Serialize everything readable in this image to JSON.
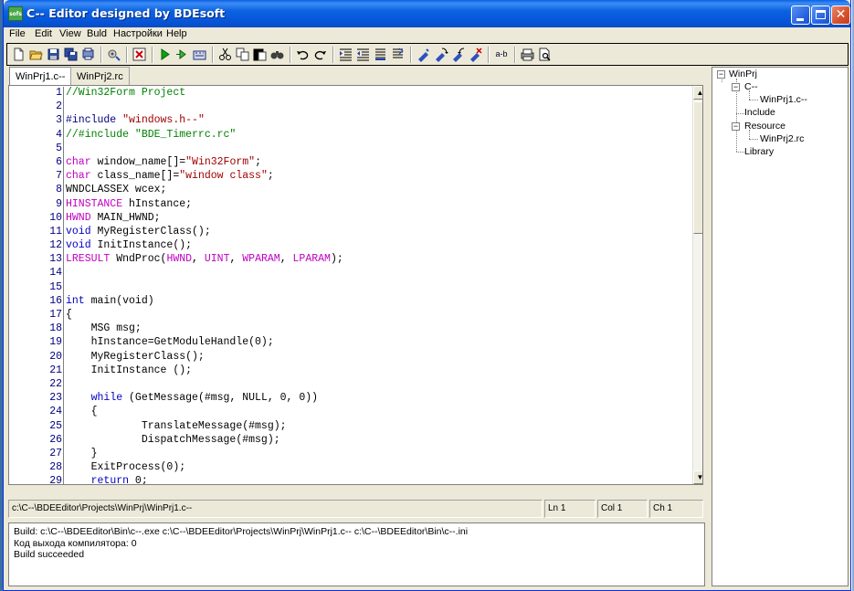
{
  "window": {
    "title": "C-- Editor designed by BDEsoft",
    "icon_label": "sofs",
    "buttons": [
      "minimize",
      "maximize",
      "close"
    ]
  },
  "menu": [
    "File",
    "Edit",
    "View",
    "Buld",
    "Настройки",
    "Help"
  ],
  "toolbar": {
    "icons": [
      "new-file-icon",
      "open-folder-icon",
      "save-icon",
      "save-all-icon",
      "print-setup-icon",
      "settings-icon",
      "compile-icon",
      "stop-icon",
      "run-icon",
      "step-icon",
      "build-all-icon",
      "cut-icon",
      "copy-icon",
      "paste-icon",
      "find-icon",
      "undo-icon",
      "redo-icon",
      "indent-icon",
      "outdent-icon",
      "comment-icon",
      "uncomment-icon",
      "bookmark-icon",
      "next-bookmark-icon",
      "prev-bookmark-icon",
      "clear-bookmarks-icon",
      "replace-icon",
      "print-icon",
      "print-preview-icon"
    ],
    "replace_label": "a-b"
  },
  "tabs": [
    {
      "label": "WinPrj1.c--",
      "active": true
    },
    {
      "label": "WinPrj2.rc",
      "active": false
    }
  ],
  "code": [
    {
      "n": "1",
      "tokens": [
        {
          "t": "//Win32Form Project",
          "c": "c-com"
        }
      ]
    },
    {
      "n": "2",
      "tokens": []
    },
    {
      "n": "3",
      "tokens": [
        {
          "t": "#include ",
          "c": "c-pp"
        },
        {
          "t": "\"windows.h--\"",
          "c": "c-str"
        }
      ]
    },
    {
      "n": "4",
      "tokens": [
        {
          "t": "//#include \"BDE_Timerrc.rc\"",
          "c": "c-com"
        }
      ]
    },
    {
      "n": "5",
      "tokens": []
    },
    {
      "n": "6",
      "tokens": [
        {
          "t": "char",
          "c": "c-type"
        },
        {
          "t": " window_name[]=",
          "c": "c-txt"
        },
        {
          "t": "\"Win32Form\"",
          "c": "c-str"
        },
        {
          "t": ";",
          "c": "c-txt"
        }
      ]
    },
    {
      "n": "7",
      "tokens": [
        {
          "t": "char",
          "c": "c-type"
        },
        {
          "t": " class_name[]=",
          "c": "c-txt"
        },
        {
          "t": "\"window class\"",
          "c": "c-str"
        },
        {
          "t": ";",
          "c": "c-txt"
        }
      ]
    },
    {
      "n": "8",
      "tokens": [
        {
          "t": "WNDCLASSEX wcex;",
          "c": "c-txt"
        }
      ]
    },
    {
      "n": "9",
      "tokens": [
        {
          "t": "HINSTANCE",
          "c": "c-type"
        },
        {
          "t": " hInstance;",
          "c": "c-txt"
        }
      ]
    },
    {
      "n": "10",
      "tokens": [
        {
          "t": "HWND",
          "c": "c-type"
        },
        {
          "t": " MAIN_HWND;",
          "c": "c-txt"
        }
      ]
    },
    {
      "n": "11",
      "tokens": [
        {
          "t": "void",
          "c": "c-kw"
        },
        {
          "t": " MyRegisterClass();",
          "c": "c-txt"
        }
      ]
    },
    {
      "n": "12",
      "tokens": [
        {
          "t": "void",
          "c": "c-kw"
        },
        {
          "t": " InitInstance();",
          "c": "c-txt"
        }
      ]
    },
    {
      "n": "13",
      "tokens": [
        {
          "t": "LRESULT",
          "c": "c-type"
        },
        {
          "t": " WndProc(",
          "c": "c-txt"
        },
        {
          "t": "HWND",
          "c": "c-type"
        },
        {
          "t": ", ",
          "c": "c-txt"
        },
        {
          "t": "UINT",
          "c": "c-type"
        },
        {
          "t": ", ",
          "c": "c-txt"
        },
        {
          "t": "WPARAM",
          "c": "c-type"
        },
        {
          "t": ", ",
          "c": "c-txt"
        },
        {
          "t": "LPARAM",
          "c": "c-type"
        },
        {
          "t": ");",
          "c": "c-txt"
        }
      ]
    },
    {
      "n": "14",
      "tokens": []
    },
    {
      "n": "15",
      "tokens": []
    },
    {
      "n": "16",
      "tokens": [
        {
          "t": "int",
          "c": "c-kw"
        },
        {
          "t": " main(void)",
          "c": "c-txt"
        }
      ]
    },
    {
      "n": "17",
      "tokens": [
        {
          "t": "{",
          "c": "c-txt"
        }
      ]
    },
    {
      "n": "18",
      "tokens": [
        {
          "t": "    MSG msg;",
          "c": "c-txt"
        }
      ]
    },
    {
      "n": "19",
      "tokens": [
        {
          "t": "    hInstance=GetModuleHandle(0);",
          "c": "c-txt"
        }
      ]
    },
    {
      "n": "20",
      "tokens": [
        {
          "t": "    MyRegisterClass();",
          "c": "c-txt"
        }
      ]
    },
    {
      "n": "21",
      "tokens": [
        {
          "t": "    InitInstance ();",
          "c": "c-txt"
        }
      ]
    },
    {
      "n": "22",
      "tokens": []
    },
    {
      "n": "23",
      "tokens": [
        {
          "t": "    ",
          "c": "c-txt"
        },
        {
          "t": "while",
          "c": "c-kw"
        },
        {
          "t": " (GetMessage(#msg, NULL, 0, 0))",
          "c": "c-txt"
        }
      ]
    },
    {
      "n": "24",
      "tokens": [
        {
          "t": "    {",
          "c": "c-txt"
        }
      ]
    },
    {
      "n": "25",
      "tokens": [
        {
          "t": "            TranslateMessage(#msg);",
          "c": "c-txt"
        }
      ]
    },
    {
      "n": "26",
      "tokens": [
        {
          "t": "            DispatchMessage(#msg);",
          "c": "c-txt"
        }
      ]
    },
    {
      "n": "27",
      "tokens": [
        {
          "t": "    }",
          "c": "c-txt"
        }
      ]
    },
    {
      "n": "28",
      "tokens": [
        {
          "t": "    ExitProcess(0);",
          "c": "c-txt"
        }
      ]
    },
    {
      "n": "29",
      "tokens": [
        {
          "t": "    ",
          "c": "c-txt"
        },
        {
          "t": "return",
          "c": "c-kw"
        },
        {
          "t": " 0;",
          "c": "c-txt"
        }
      ]
    }
  ],
  "status": {
    "path": "c:\\C--\\BDEEditor\\Projects\\WinPrj\\WinPrj1.c--",
    "ln": "Ln 1",
    "col": "Col 1",
    "ch": "Ch 1"
  },
  "output": [
    "Build: c:\\C--\\BDEEditor\\Bin\\c--.exe c:\\C--\\BDEEditor\\Projects\\WinPrj\\WinPrj1.c-- c:\\C--\\BDEEditor\\Bin\\c--.ini",
    "Код выхода компилятора: 0",
    "Build succeeded"
  ],
  "tree": {
    "root": "WinPrj",
    "group_c": "C--",
    "file_c": "WinPrj1.c--",
    "include": "Include",
    "resource": "Resource",
    "file_rc": "WinPrj2.rc",
    "library": "Library"
  }
}
